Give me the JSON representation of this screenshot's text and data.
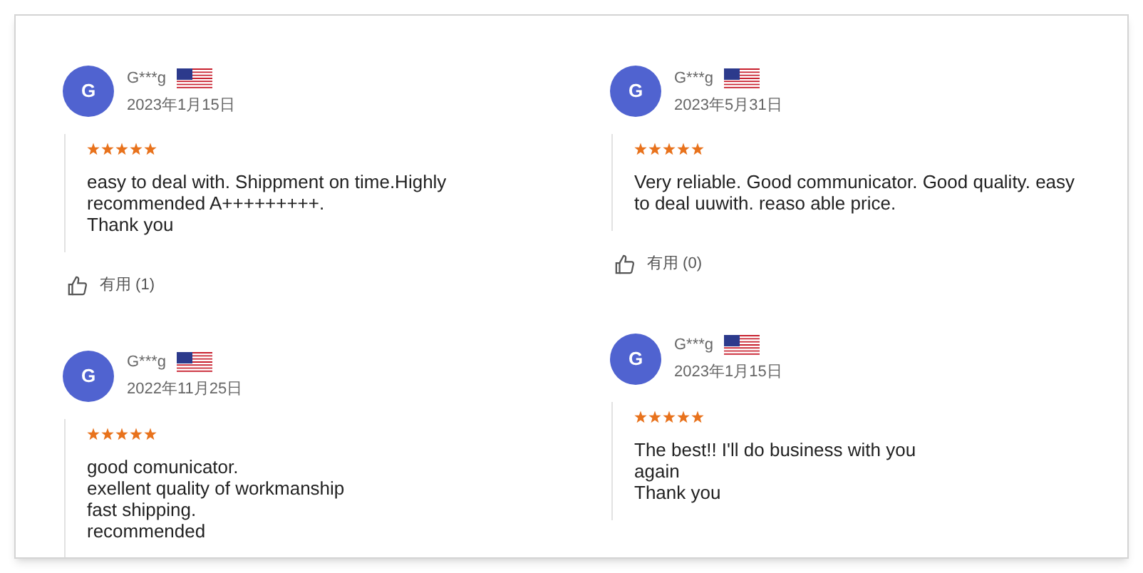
{
  "columns": [
    {
      "reviews": [
        {
          "avatar": "G",
          "name": "G***g",
          "date": "2023年1月15日",
          "stars": 5,
          "text": "easy to deal with. Shippment on time.Highly\nrecommended A+++++++++.\nThank you",
          "helpful": "有用 (1)"
        },
        {
          "avatar": "G",
          "name": "G***g",
          "date": "2022年11月25日",
          "stars": 5,
          "text": "good comunicator.\nexellent quality of workmanship\nfast shipping.\nrecommended"
        }
      ]
    },
    {
      "reviews": [
        {
          "avatar": "G",
          "name": "G***g",
          "date": "2023年5月31日",
          "stars": 5,
          "text": "Very reliable. Good communicator. Good quality. easy\nto deal uuwith. reaso able price.",
          "helpful": "有用 (0)"
        },
        {
          "avatar": "G",
          "name": "G***g",
          "date": "2023年1月15日",
          "stars": 5,
          "text": "The best!! I'll do business with you\nagain\nThank you"
        }
      ]
    }
  ]
}
